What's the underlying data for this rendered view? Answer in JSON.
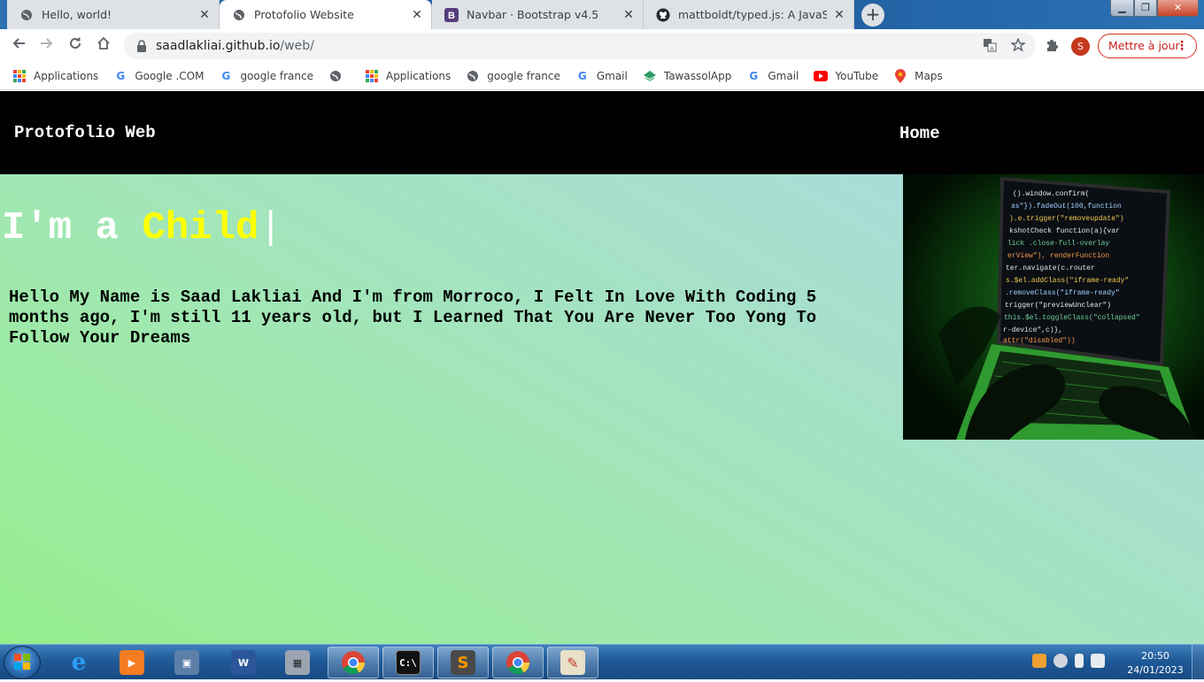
{
  "browser": {
    "tabs": [
      {
        "title": "Hello, world!",
        "active": false
      },
      {
        "title": "Protofolio Website",
        "active": true
      },
      {
        "title": "Navbar · Bootstrap v4.5",
        "active": false
      },
      {
        "title": "mattboldt/typed.js: A JavaScript T",
        "active": false
      }
    ],
    "tab_close_glyph": "✕",
    "new_tab_glyph": "+",
    "address": {
      "host": "saadlakliai.github.io",
      "path": "/web/"
    },
    "profile_initial": "S",
    "update_button": "Mettre à jour",
    "bookmarks": [
      {
        "label": "Applications",
        "icon": "apps-grid-icon"
      },
      {
        "label": "Google .COM",
        "icon": "google-icon"
      },
      {
        "label": "google france",
        "icon": "google-icon"
      },
      {
        "label": "",
        "icon": "globe-icon"
      },
      {
        "label": "Applications",
        "icon": "apps-grid-icon"
      },
      {
        "label": "google france",
        "icon": "globe-icon"
      },
      {
        "label": "Gmail",
        "icon": "google-icon"
      },
      {
        "label": "TawassolApp",
        "icon": "tawassol-icon"
      },
      {
        "label": "Gmail",
        "icon": "google-icon"
      },
      {
        "label": "YouTube",
        "icon": "youtube-icon"
      },
      {
        "label": "Maps",
        "icon": "maps-icon"
      }
    ]
  },
  "site": {
    "brand": "Protofolio Web",
    "nav_home": "Home",
    "headline_prefix": "I'm a ",
    "headline_typed": "Child",
    "cursor": "|",
    "intro": "Hello My Name is Saad Lakliai And I'm from Morroco, I Felt In Love With Coding 5 months ago, I'm still 11 years old, but I Learned That You Are Never Too Yong To Follow Your Dreams"
  },
  "taskbar": {
    "time": "20:50",
    "date": "24/01/2023"
  },
  "colors": {
    "typed_accent": "#ffff00",
    "nav_background": "#000000",
    "hero_gradient_start": "#96ee8e",
    "hero_gradient_end": "#acd8e4"
  }
}
